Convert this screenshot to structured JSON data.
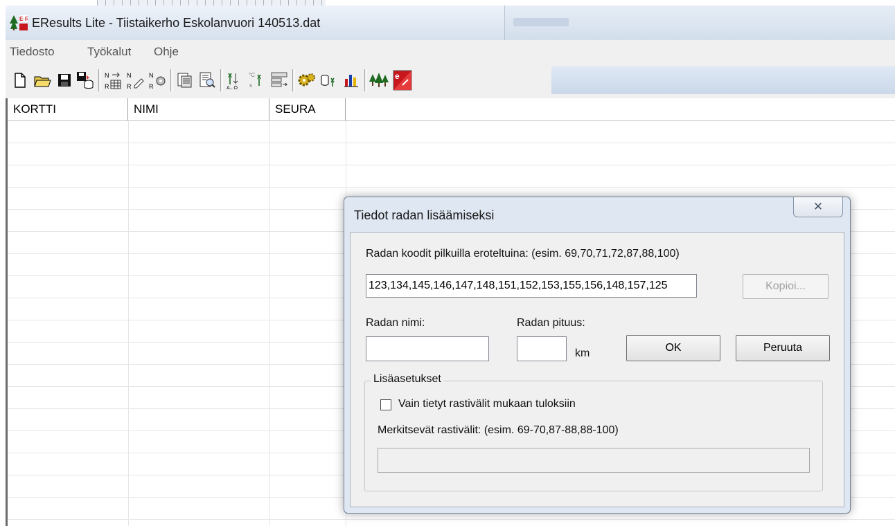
{
  "window": {
    "title": "EResults Lite - Tiistaikerho Eskolanvuori 140513.dat"
  },
  "menu": {
    "items": [
      "Tiedosto",
      "Työkalut",
      "Ohje"
    ]
  },
  "toolbar": {
    "icons": [
      "new-file-icon",
      "open-folder-icon",
      "save-icon",
      "save-database-icon",
      "import-icon",
      "edit-icon",
      "settings-icon",
      "print-icon",
      "print-preview-icon",
      "sort-icon",
      "filter-icon",
      "split-icon",
      "gear-icon",
      "database-icon",
      "chart-icon",
      "trees-icon",
      "eresults-icon"
    ]
  },
  "grid": {
    "columns": [
      "KORTTI",
      "NIMI",
      "SEURA"
    ],
    "rows": []
  },
  "dialog": {
    "title": "Tiedot radan lisäämiseksi",
    "close_symbol": "✕",
    "codes_label": "Radan koodit pilkuilla eroteltuina: (esim. 69,70,71,72,87,88,100)",
    "codes_value": "123,134,145,146,147,148,151,152,153,155,156,148,157,125",
    "copy_button": "Kopioi...",
    "name_label": "Radan nimi:",
    "name_value": "",
    "length_label": "Radan pituus:",
    "length_value": "",
    "length_unit": "km",
    "ok_button": "OK",
    "cancel_button": "Peruuta",
    "advanced": {
      "legend": "Lisäasetukset",
      "checkbox_label": "Vain tietyt rastivälit mukaan tuloksiin",
      "checkbox_checked": false,
      "legs_label": "Merkitsevät rastivälit: (esim. 69-70,87-88,88-100)",
      "legs_value": ""
    }
  },
  "colors": {
    "titlebar": "#dfe7f2",
    "dialog_frame": "#dfe7f2",
    "dialog_body": "#f0f0f0",
    "grid_line": "#e6e6e6"
  }
}
